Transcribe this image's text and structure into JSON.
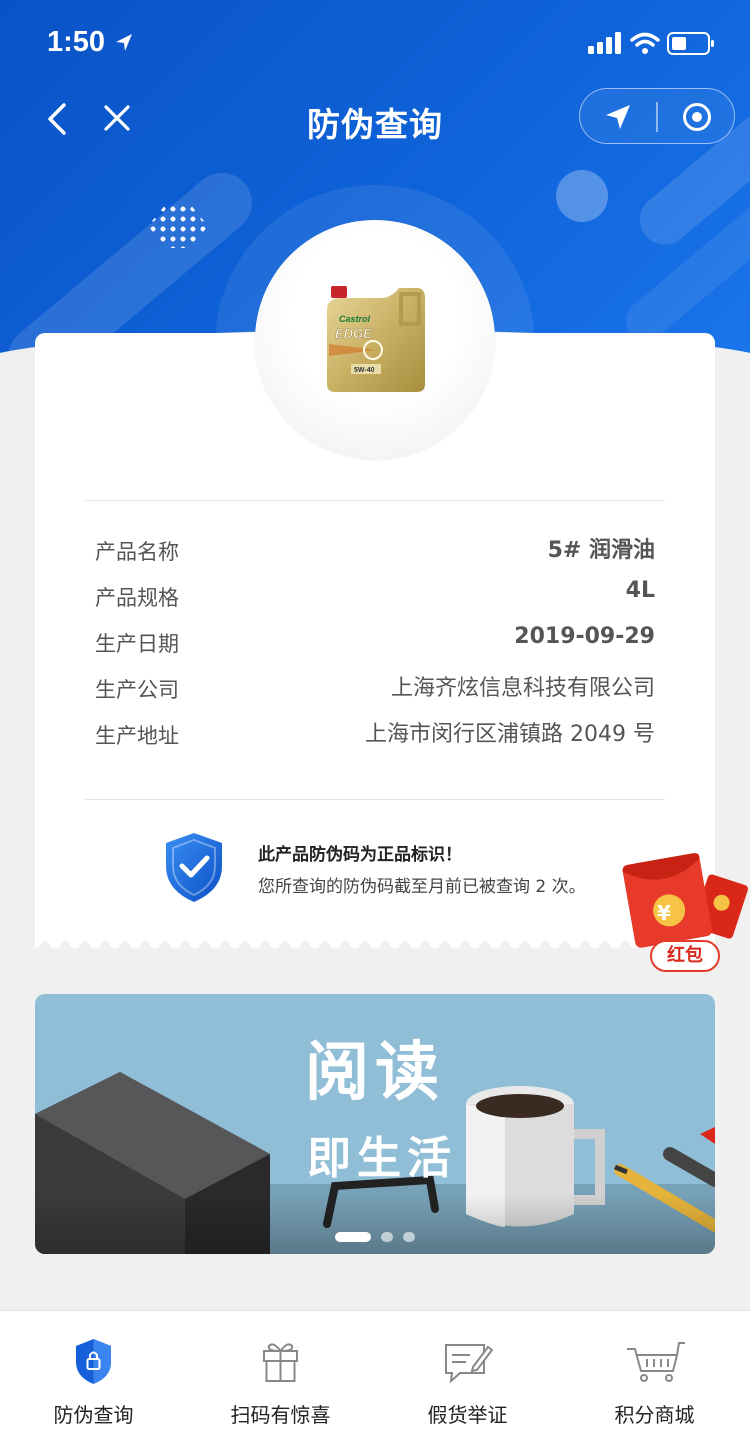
{
  "status_bar": {
    "time": "1:50"
  },
  "nav": {
    "title": "防伪查询"
  },
  "product": {
    "image": "castrol-edge-oil-bottle",
    "brand_text": "Castrol",
    "model_text": "EDGE",
    "grade_text": "5W-40"
  },
  "info": [
    {
      "label": "产品名称",
      "value": "5# 润滑油"
    },
    {
      "label": "产品规格",
      "value": "4L"
    },
    {
      "label": "生产日期",
      "value": "2019-09-29"
    },
    {
      "label": "生产公司",
      "value": "上海齐炫信息科技有限公司"
    },
    {
      "label": "生产地址",
      "value": "上海市闵行区浦镇路 2049 号"
    }
  ],
  "verification": {
    "title": "此产品防伪码为正品标识！",
    "message": "您所查询的防伪码截至月前已被查询 2 次。"
  },
  "red_packet": {
    "label": "红包",
    "symbol": "¥"
  },
  "banner": {
    "title": "阅读",
    "subtitle": "即生活",
    "active_slide": 1,
    "total_slides": 3
  },
  "tabs": [
    {
      "label": "防伪查询",
      "icon": "shield-lock-icon",
      "active": true
    },
    {
      "label": "扫码有惊喜",
      "icon": "gift-icon",
      "active": false
    },
    {
      "label": "假货举证",
      "icon": "report-edit-icon",
      "active": false
    },
    {
      "label": "积分商城",
      "icon": "cart-icon",
      "active": false
    }
  ],
  "colors": {
    "primary": "#0f63d9",
    "background": "#f0f0f0",
    "red_packet": "#e83a2a",
    "text_muted": "#555555"
  }
}
